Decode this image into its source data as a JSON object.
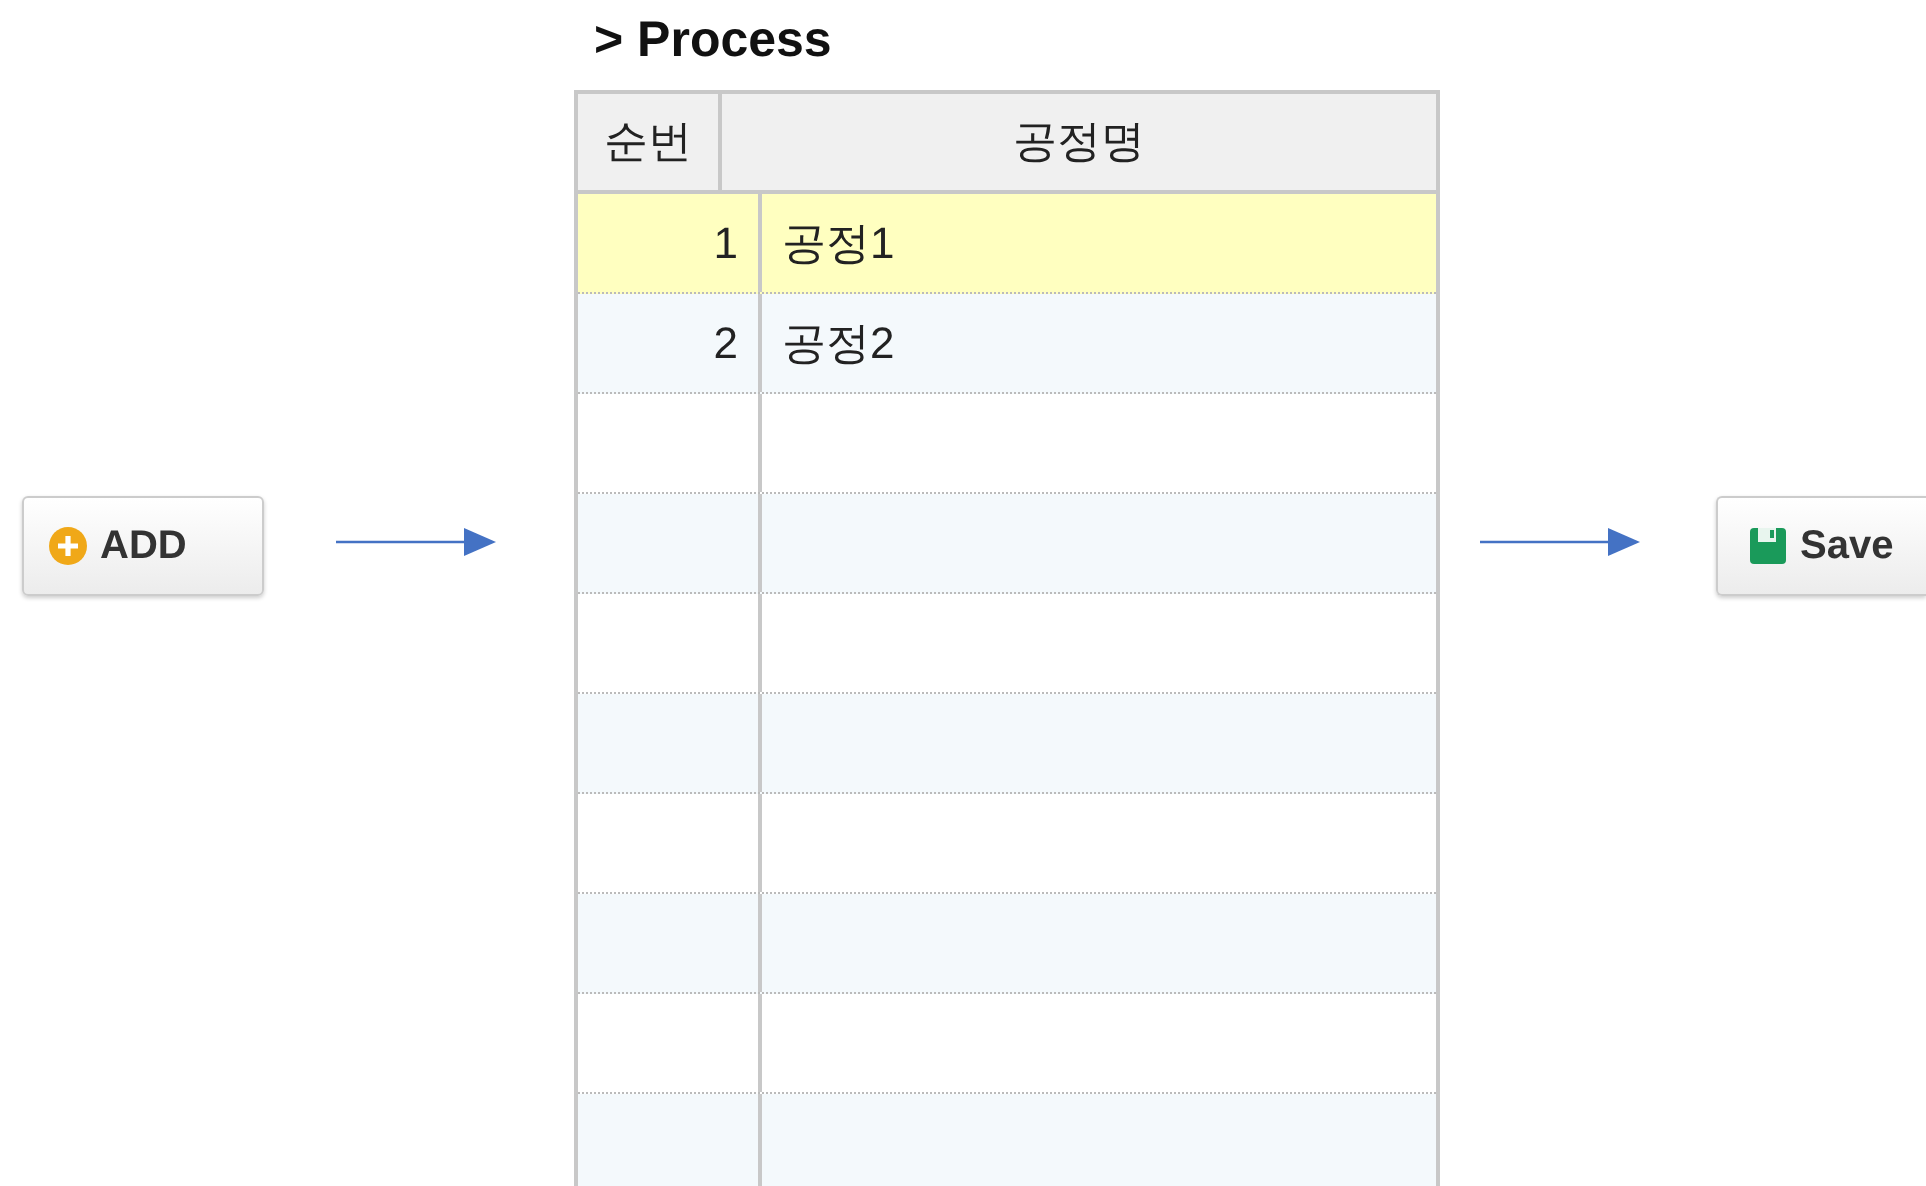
{
  "add_button": {
    "label": "ADD"
  },
  "panel": {
    "title": "> Process"
  },
  "table": {
    "columns": [
      "순번",
      "공정명"
    ],
    "rows": [
      {
        "cells": [
          "1",
          "공정1"
        ],
        "selected": true
      },
      {
        "cells": [
          "2",
          "공정2"
        ],
        "selected": false
      }
    ]
  },
  "save_button": {
    "label": "Save"
  }
}
